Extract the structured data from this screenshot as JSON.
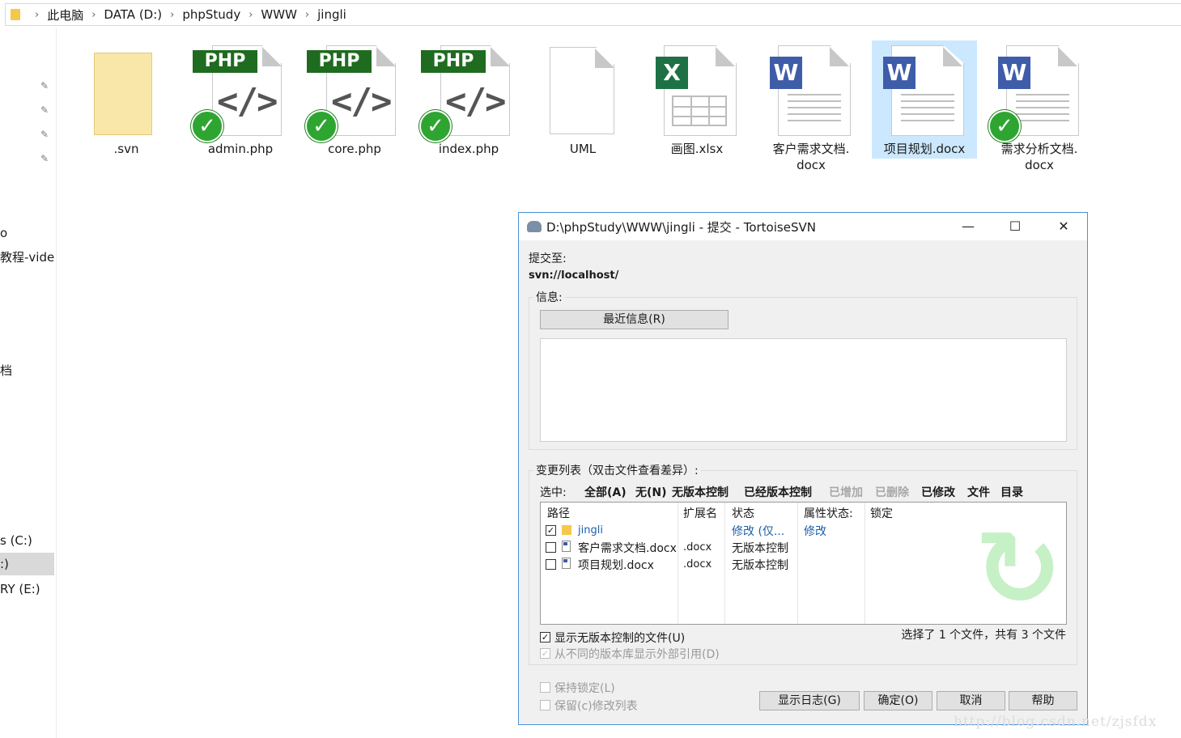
{
  "explorer": {
    "breadcrumb": [
      "此电脑",
      "DATA (D:)",
      "phpStudy",
      "WWW",
      "jingli"
    ],
    "nav_items": [
      {
        "label": "o"
      },
      {
        "label": "教程-vide"
      },
      {
        "label": "档"
      },
      {
        "label": "s (C:)"
      },
      {
        "label": ":)"
      },
      {
        "label": "RY (E:)"
      }
    ],
    "files": [
      {
        "label": ".svn",
        "icon": "folder-icon"
      },
      {
        "label": "admin.php",
        "icon": "php-file-icon",
        "svn_status": "normal"
      },
      {
        "label": "core.php",
        "icon": "php-file-icon",
        "svn_status": "normal"
      },
      {
        "label": "index.php",
        "icon": "php-file-icon",
        "svn_status": "normal"
      },
      {
        "label": "UML",
        "icon": "blank-file-icon"
      },
      {
        "label": "画图.xlsx",
        "icon": "excel-file-icon"
      },
      {
        "label1": "客户需求文档.",
        "label2": "docx",
        "icon": "word-file-icon"
      },
      {
        "label": "项目规划.docx",
        "icon": "word-file-icon",
        "selected": true
      },
      {
        "label1": "需求分析文档.",
        "label2": "docx",
        "icon": "word-file-icon",
        "svn_status": "normal"
      }
    ],
    "php_badge": "PHP",
    "code_glyph": "</>",
    "excel_badge": "X",
    "word_badge": "W"
  },
  "dialog": {
    "title": "D:\\phpStudy\\WWW\\jingli - 提交 - TortoiseSVN",
    "commit_to_label": "提交至:",
    "commit_url": "svn://localhost/",
    "message_group": "信息:",
    "recent_messages_button": "最近信息(R)",
    "changes_group": "变更列表（双击文件查看差异）:",
    "select_label": "选中:",
    "filters": [
      {
        "label": "全部(A)",
        "enabled": true
      },
      {
        "label": "无(N)",
        "enabled": true
      },
      {
        "label": "无版本控制",
        "enabled": true
      },
      {
        "label": "已经版本控制",
        "enabled": true
      },
      {
        "label": "已增加",
        "enabled": false
      },
      {
        "label": "已删除",
        "enabled": false
      },
      {
        "label": "已修改",
        "enabled": true
      },
      {
        "label": "文件",
        "enabled": true
      },
      {
        "label": "目录",
        "enabled": true
      }
    ],
    "columns": [
      "路径",
      "扩展名",
      "状态",
      "属性状态:",
      "锁定"
    ],
    "rows": [
      {
        "checked": true,
        "path": "jingli",
        "ext": "",
        "status": "修改 (仅...",
        "prop_status": "修改",
        "lock": ""
      },
      {
        "checked": false,
        "path": "客户需求文档.docx",
        "ext": ".docx",
        "status": "无版本控制",
        "prop_status": "",
        "lock": ""
      },
      {
        "checked": false,
        "path": "项目规划.docx",
        "ext": ".docx",
        "status": "无版本控制",
        "prop_status": "",
        "lock": ""
      }
    ],
    "selection_summary": "选择了 1 个文件，共有 3 个文件",
    "show_unversioned": "显示无版本控制的文件(U)",
    "show_externals": "从不同的版本库显示外部引用(D)",
    "keep_locks": "保持锁定(L)",
    "keep_changelists": "保留(c)修改列表",
    "buttons": {
      "show_log": "显示日志(G)",
      "ok": "确定(O)",
      "cancel": "取消",
      "help": "帮助"
    },
    "window_controls": {
      "minimize": "—",
      "maximize": "☐",
      "close": "✕"
    }
  },
  "watermark": "http://blog.csdn.net/zjsfdx"
}
